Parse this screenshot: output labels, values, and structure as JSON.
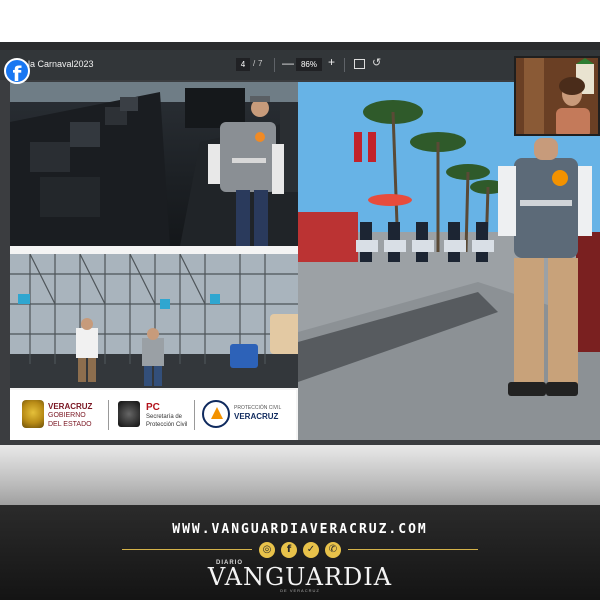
{
  "viewer": {
    "document_title": "la Carnaval2023",
    "page_current": "4",
    "page_separator": "/",
    "page_total": "7",
    "zoom_minus": "—",
    "zoom_value": "86%",
    "zoom_plus": "+"
  },
  "overlay": {
    "facebook_glyph": "f"
  },
  "slide": {
    "logos": {
      "veracruz_line1": "VERACRUZ",
      "veracruz_line2": "GOBIERNO",
      "veracruz_line3": "DEL ESTADO",
      "pc_abbrev": "PC",
      "pc_line2": "Secretaría de",
      "pc_line3": "Protección Civil",
      "proteccion_line1": "PROTECCIÓN CIVIL",
      "proteccion_line2": "VERACRUZ"
    }
  },
  "footer": {
    "url": "WWW.VANGUARDIAVERACRUZ.COM",
    "social_icons": [
      "instagram-icon",
      "facebook-icon",
      "twitter-icon",
      "whatsapp-icon"
    ],
    "brand_small": "DIARIO",
    "brand": "VANGUARDIA",
    "brand_sub": "DE VERACRUZ"
  },
  "colors": {
    "toolbar": "#323639",
    "facebook": "#1877f2",
    "footer_accent": "#d4b24a",
    "pc_red": "#b3121b",
    "veracruz_maroon": "#7a1622"
  }
}
